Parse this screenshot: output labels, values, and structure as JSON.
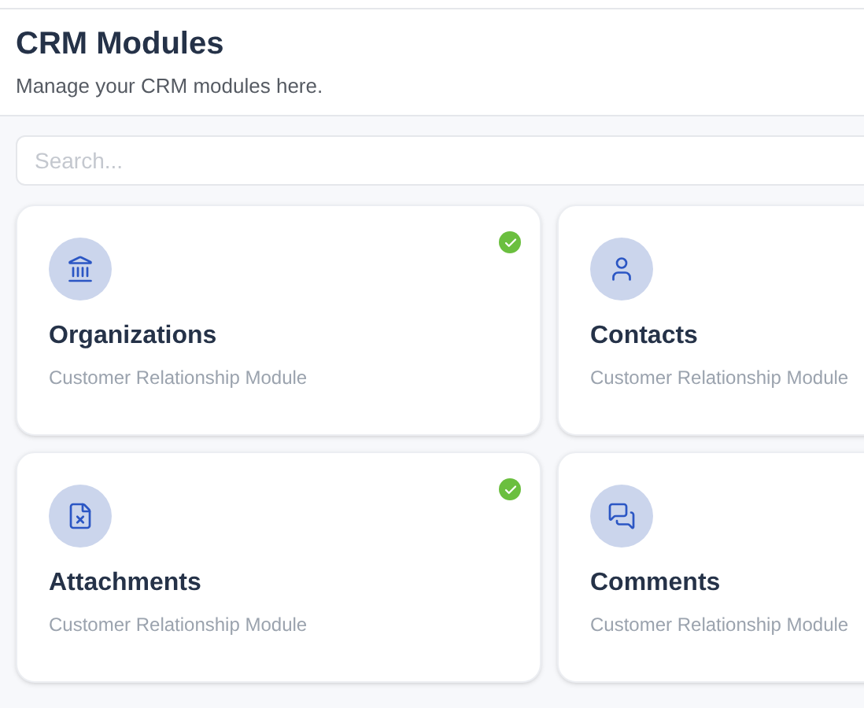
{
  "header": {
    "title": "CRM Modules",
    "subtitle": "Manage your CRM modules here."
  },
  "search": {
    "placeholder": "Search..."
  },
  "modules": [
    {
      "name": "Organizations",
      "description": "Customer Relationship Module",
      "kind": "bank",
      "enabled": true
    },
    {
      "name": "Contacts",
      "description": "Customer Relationship Module",
      "kind": "user"
    },
    {
      "name": "Attachments",
      "description": "Customer Relationship Module",
      "kind": "file",
      "enabled": true
    },
    {
      "name": "Comments",
      "description": "Customer Relationship Module",
      "kind": "chat"
    }
  ]
}
